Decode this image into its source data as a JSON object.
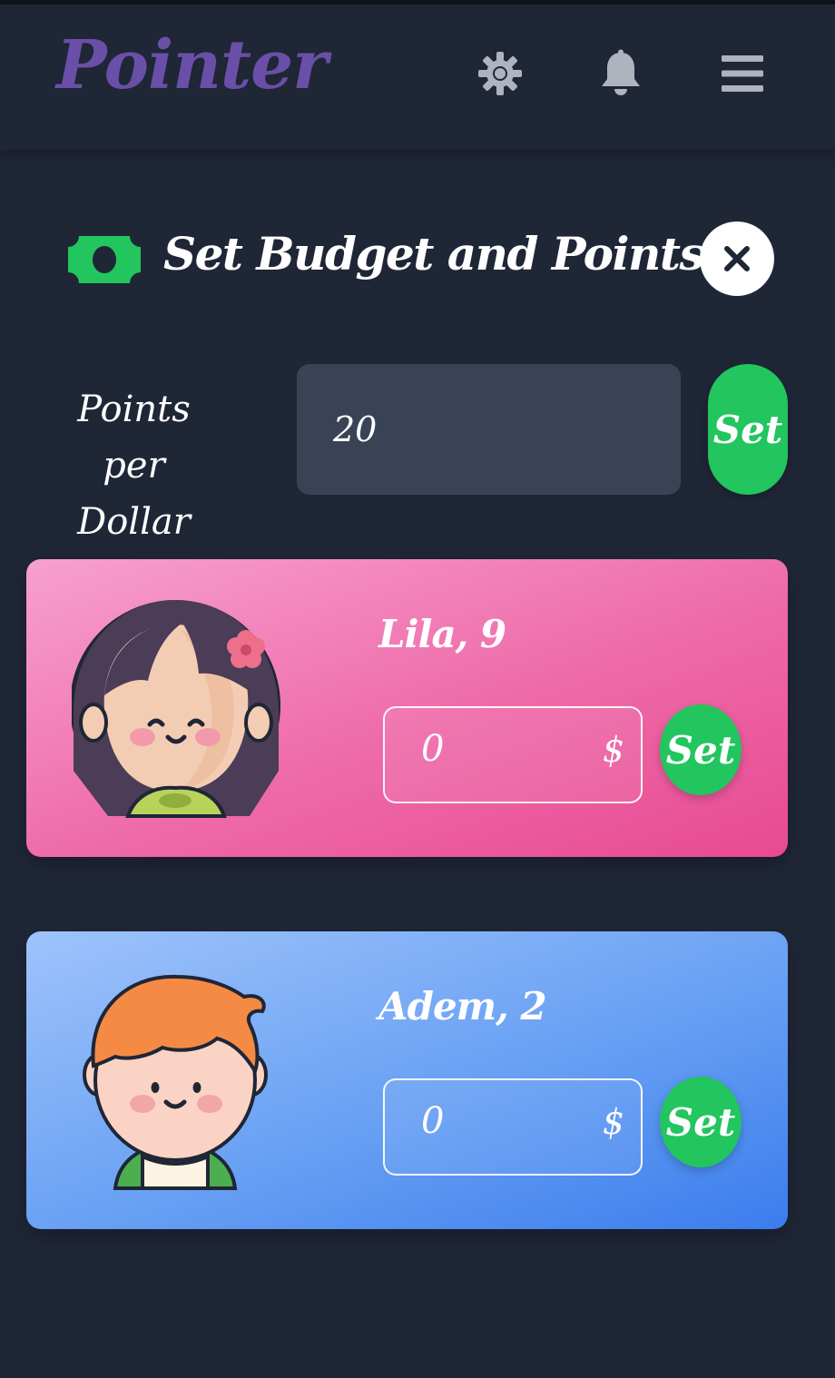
{
  "app": {
    "logo_text": "Pointer",
    "nav_icons": [
      "gear-icon",
      "bell-icon",
      "menu-icon"
    ]
  },
  "modal": {
    "title": "Set Budget and Points",
    "title_icon": "money-icon",
    "close_icon": "close-icon"
  },
  "points_per_dollar": {
    "label": "Points per Dollar",
    "value": "20",
    "set_label": "Set"
  },
  "kids": [
    {
      "name": "Lila, 9",
      "amount": "0",
      "currency": "$",
      "set_label": "Set",
      "color": "#ee6aa9",
      "avatar": "girl-avatar"
    },
    {
      "name": "Adem, 2",
      "amount": "0",
      "currency": "$",
      "set_label": "Set",
      "color": "#5b95f1",
      "avatar": "boy-avatar"
    }
  ],
  "colors": {
    "background": "#1f2636",
    "logo": "#6a4fa8",
    "accent_green": "#22c55e",
    "input_bg": "#3a4356"
  }
}
